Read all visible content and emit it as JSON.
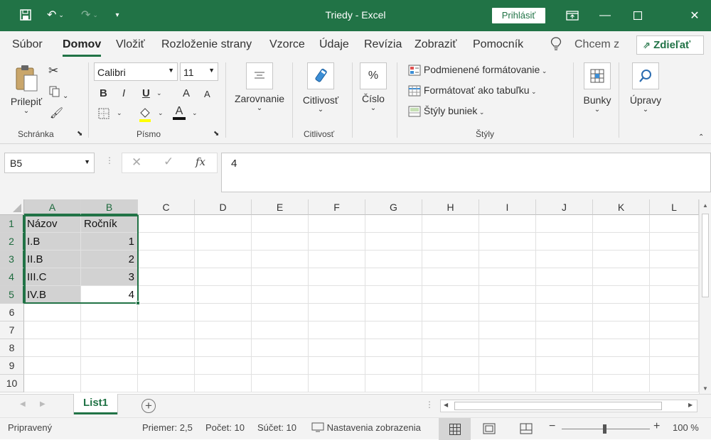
{
  "window": {
    "title": "Triedy  -  Excel",
    "signin": "Prihlásiť"
  },
  "tabs": [
    "Súbor",
    "Domov",
    "Vložiť",
    "Rozloženie strany",
    "Vzorce",
    "Údaje",
    "Revízia",
    "Zobraziť",
    "Pomocník"
  ],
  "tell_me": "Chcem z",
  "share": "Zdieľať",
  "ribbon": {
    "clipboard": {
      "paste": "Prilepiť",
      "label": "Schránka"
    },
    "font": {
      "name": "Calibri",
      "size": "11",
      "label": "Písmo",
      "bold": "B",
      "italic": "I",
      "underline": "U",
      "grow": "A",
      "shrink": "A",
      "color_letter": "A"
    },
    "alignment": {
      "label": "Zarovnanie"
    },
    "sensitivity": {
      "btn": "Citlivosť",
      "label": "Citlivosť"
    },
    "number": {
      "btn": "Číslo",
      "percent": "%"
    },
    "styles": {
      "cond": "Podmienené formátovanie",
      "table": "Formátovať ako tabuľku",
      "cell": "Štýly buniek",
      "label": "Štýly"
    },
    "cells": {
      "btn": "Bunky"
    },
    "editing": {
      "btn": "Úpravy"
    }
  },
  "formula_bar": {
    "name_box": "B5",
    "value": "4",
    "fx": "fx"
  },
  "columns": [
    "A",
    "B",
    "C",
    "D",
    "E",
    "F",
    "G",
    "H",
    "I",
    "J",
    "K",
    "L"
  ],
  "rows": [
    "1",
    "2",
    "3",
    "4",
    "5",
    "6",
    "7",
    "8",
    "9",
    "10"
  ],
  "cells": {
    "A1": "Názov",
    "B1": "Ročník",
    "A2": "I.B",
    "B2": "1",
    "A3": "II.B",
    "B3": "2",
    "A4": "III.C",
    "B4": "3",
    "A5": "IV.B",
    "B5": "4"
  },
  "sheet_tab": "List1",
  "status": {
    "ready": "Pripravený",
    "avg": "Priemer: 2,5",
    "count": "Počet: 10",
    "sum": "Súčet: 10",
    "display": "Nastavenia zobrazenia",
    "zoom": "100 %"
  },
  "colors": {
    "accent": "#217346",
    "selection": "#d2d2d2"
  }
}
